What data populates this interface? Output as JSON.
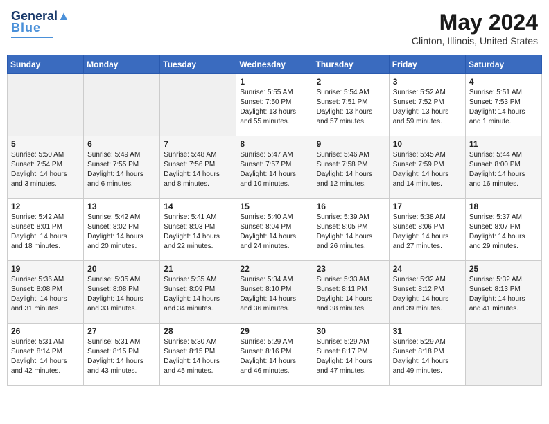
{
  "header": {
    "logo_general": "General",
    "logo_blue": "Blue",
    "month": "May 2024",
    "location": "Clinton, Illinois, United States"
  },
  "days_of_week": [
    "Sunday",
    "Monday",
    "Tuesday",
    "Wednesday",
    "Thursday",
    "Friday",
    "Saturday"
  ],
  "weeks": [
    [
      {
        "day": "",
        "info": ""
      },
      {
        "day": "",
        "info": ""
      },
      {
        "day": "",
        "info": ""
      },
      {
        "day": "1",
        "info": "Sunrise: 5:55 AM\nSunset: 7:50 PM\nDaylight: 13 hours\nand 55 minutes."
      },
      {
        "day": "2",
        "info": "Sunrise: 5:54 AM\nSunset: 7:51 PM\nDaylight: 13 hours\nand 57 minutes."
      },
      {
        "day": "3",
        "info": "Sunrise: 5:52 AM\nSunset: 7:52 PM\nDaylight: 13 hours\nand 59 minutes."
      },
      {
        "day": "4",
        "info": "Sunrise: 5:51 AM\nSunset: 7:53 PM\nDaylight: 14 hours\nand 1 minute."
      }
    ],
    [
      {
        "day": "5",
        "info": "Sunrise: 5:50 AM\nSunset: 7:54 PM\nDaylight: 14 hours\nand 3 minutes."
      },
      {
        "day": "6",
        "info": "Sunrise: 5:49 AM\nSunset: 7:55 PM\nDaylight: 14 hours\nand 6 minutes."
      },
      {
        "day": "7",
        "info": "Sunrise: 5:48 AM\nSunset: 7:56 PM\nDaylight: 14 hours\nand 8 minutes."
      },
      {
        "day": "8",
        "info": "Sunrise: 5:47 AM\nSunset: 7:57 PM\nDaylight: 14 hours\nand 10 minutes."
      },
      {
        "day": "9",
        "info": "Sunrise: 5:46 AM\nSunset: 7:58 PM\nDaylight: 14 hours\nand 12 minutes."
      },
      {
        "day": "10",
        "info": "Sunrise: 5:45 AM\nSunset: 7:59 PM\nDaylight: 14 hours\nand 14 minutes."
      },
      {
        "day": "11",
        "info": "Sunrise: 5:44 AM\nSunset: 8:00 PM\nDaylight: 14 hours\nand 16 minutes."
      }
    ],
    [
      {
        "day": "12",
        "info": "Sunrise: 5:42 AM\nSunset: 8:01 PM\nDaylight: 14 hours\nand 18 minutes."
      },
      {
        "day": "13",
        "info": "Sunrise: 5:42 AM\nSunset: 8:02 PM\nDaylight: 14 hours\nand 20 minutes."
      },
      {
        "day": "14",
        "info": "Sunrise: 5:41 AM\nSunset: 8:03 PM\nDaylight: 14 hours\nand 22 minutes."
      },
      {
        "day": "15",
        "info": "Sunrise: 5:40 AM\nSunset: 8:04 PM\nDaylight: 14 hours\nand 24 minutes."
      },
      {
        "day": "16",
        "info": "Sunrise: 5:39 AM\nSunset: 8:05 PM\nDaylight: 14 hours\nand 26 minutes."
      },
      {
        "day": "17",
        "info": "Sunrise: 5:38 AM\nSunset: 8:06 PM\nDaylight: 14 hours\nand 27 minutes."
      },
      {
        "day": "18",
        "info": "Sunrise: 5:37 AM\nSunset: 8:07 PM\nDaylight: 14 hours\nand 29 minutes."
      }
    ],
    [
      {
        "day": "19",
        "info": "Sunrise: 5:36 AM\nSunset: 8:08 PM\nDaylight: 14 hours\nand 31 minutes."
      },
      {
        "day": "20",
        "info": "Sunrise: 5:35 AM\nSunset: 8:08 PM\nDaylight: 14 hours\nand 33 minutes."
      },
      {
        "day": "21",
        "info": "Sunrise: 5:35 AM\nSunset: 8:09 PM\nDaylight: 14 hours\nand 34 minutes."
      },
      {
        "day": "22",
        "info": "Sunrise: 5:34 AM\nSunset: 8:10 PM\nDaylight: 14 hours\nand 36 minutes."
      },
      {
        "day": "23",
        "info": "Sunrise: 5:33 AM\nSunset: 8:11 PM\nDaylight: 14 hours\nand 38 minutes."
      },
      {
        "day": "24",
        "info": "Sunrise: 5:32 AM\nSunset: 8:12 PM\nDaylight: 14 hours\nand 39 minutes."
      },
      {
        "day": "25",
        "info": "Sunrise: 5:32 AM\nSunset: 8:13 PM\nDaylight: 14 hours\nand 41 minutes."
      }
    ],
    [
      {
        "day": "26",
        "info": "Sunrise: 5:31 AM\nSunset: 8:14 PM\nDaylight: 14 hours\nand 42 minutes."
      },
      {
        "day": "27",
        "info": "Sunrise: 5:31 AM\nSunset: 8:15 PM\nDaylight: 14 hours\nand 43 minutes."
      },
      {
        "day": "28",
        "info": "Sunrise: 5:30 AM\nSunset: 8:15 PM\nDaylight: 14 hours\nand 45 minutes."
      },
      {
        "day": "29",
        "info": "Sunrise: 5:29 AM\nSunset: 8:16 PM\nDaylight: 14 hours\nand 46 minutes."
      },
      {
        "day": "30",
        "info": "Sunrise: 5:29 AM\nSunset: 8:17 PM\nDaylight: 14 hours\nand 47 minutes."
      },
      {
        "day": "31",
        "info": "Sunrise: 5:29 AM\nSunset: 8:18 PM\nDaylight: 14 hours\nand 49 minutes."
      },
      {
        "day": "",
        "info": ""
      }
    ]
  ]
}
